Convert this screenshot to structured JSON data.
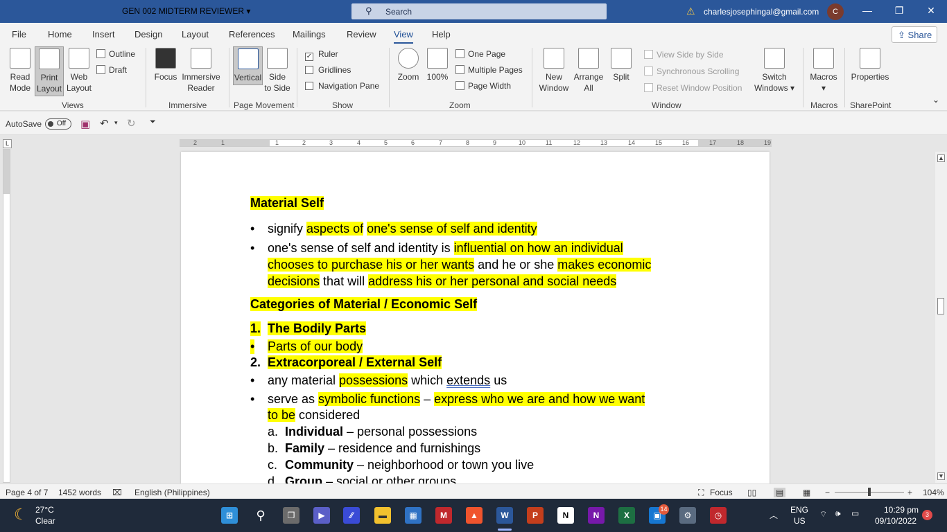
{
  "window": {
    "doc_title": "GEN 002 MIDTERM REVIEWER",
    "search_placeholder": "Search",
    "account_email": "charlesjosephingal@gmail.com",
    "avatar_initial": "C"
  },
  "menu": {
    "tabs": [
      "File",
      "Home",
      "Insert",
      "Design",
      "Layout",
      "References",
      "Mailings",
      "Review",
      "View",
      "Help"
    ],
    "active_tab": "View",
    "share": "Share"
  },
  "ribbon": {
    "views": {
      "read_mode": [
        "Read",
        "Mode"
      ],
      "print_layout": [
        "Print",
        "Layout"
      ],
      "web_layout": [
        "Web",
        "Layout"
      ],
      "outline": "Outline",
      "draft": "Draft",
      "group": "Views"
    },
    "immersive": {
      "focus": "Focus",
      "immersive_reader": [
        "Immersive",
        "Reader"
      ],
      "group": "Immersive"
    },
    "page_movement": {
      "vertical": "Vertical",
      "side_to_side": [
        "Side",
        "to Side"
      ],
      "group": "Page Movement"
    },
    "show": {
      "ruler": "Ruler",
      "gridlines": "Gridlines",
      "navigation_pane": "Navigation Pane",
      "group": "Show"
    },
    "zoom": {
      "zoom": "Zoom",
      "hundred": "100%",
      "one_page": "One Page",
      "multiple_pages": "Multiple Pages",
      "page_width": "Page Width",
      "group": "Zoom"
    },
    "window": {
      "new_window": [
        "New",
        "Window"
      ],
      "arrange_all": [
        "Arrange",
        "All"
      ],
      "split": "Split",
      "view_side_by_side": "View Side by Side",
      "synchronous_scrolling": "Synchronous Scrolling",
      "reset_window_position": "Reset Window Position",
      "switch_windows": [
        "Switch",
        "Windows"
      ],
      "group": "Window"
    },
    "macros": {
      "macros": "Macros",
      "group": "Macros"
    },
    "sharepoint": {
      "properties": "Properties",
      "group": "SharePoint"
    }
  },
  "qat": {
    "autosave": "AutoSave",
    "autosave_state": "Off"
  },
  "document": {
    "heading1": "Material Self",
    "b1_plain": "signify ",
    "b1_hl1": "aspects of",
    "b1_hl2": "one's sense of self and identity",
    "b2_line1_plain": "one's sense of self and identity is ",
    "b2_line1_hl": "influential on how an individual",
    "b2_line2_hl": "chooses to purchase his or her wants",
    "b2_line2_plain": " and he or she ",
    "b2_line2_hl2": "makes economic",
    "b2_line3_hl": "decisions",
    "b2_line3_plain": " that will ",
    "b2_line3_hl2": "address his or her personal and social needs",
    "heading2": "Categories of Material / Economic Self",
    "n1_num": "1.",
    "n1_text": "The Bodily Parts",
    "n1_sub": "Parts of our body",
    "n2_num": "2.",
    "n2_text": "Extracorporeal / External Self",
    "b3_plain1": "any material ",
    "b3_hl": "possessions",
    "b3_plain2": " which ",
    "b3_ul": "extends",
    "b3_plain3": " us",
    "b4_plain1": "serve as ",
    "b4_hl1": "symbolic functions",
    "b4_plain2": " – ",
    "b4_hl2": "express who we are and how we want",
    "b4_line2_hl": "to be",
    "b4_line2_plain": " considered",
    "letters": [
      {
        "l": "a.",
        "bold": "Individual",
        "rest": " – personal possessions"
      },
      {
        "l": "b.",
        "bold": "Family",
        "rest": " – residence and furnishings"
      },
      {
        "l": "c.",
        "bold": "Community",
        "rest": " – neighborhood or town you live"
      },
      {
        "l": "d.",
        "bold": "Group",
        "rest": " – social or other groups"
      }
    ]
  },
  "status": {
    "page": "Page 4 of 7",
    "words": "1452 words",
    "language": "English (Philippines)",
    "focus": "Focus",
    "zoom": "104%"
  },
  "taskbar": {
    "temperature": "27°C",
    "weather": "Clear",
    "lang1": "ENG",
    "lang2": "US",
    "time": "10:29 pm",
    "date": "09/10/2022",
    "teams_badge": "14",
    "notif_badge": "3"
  },
  "colors": {
    "accent": "#2b579a",
    "highlight": "#ffff00"
  }
}
